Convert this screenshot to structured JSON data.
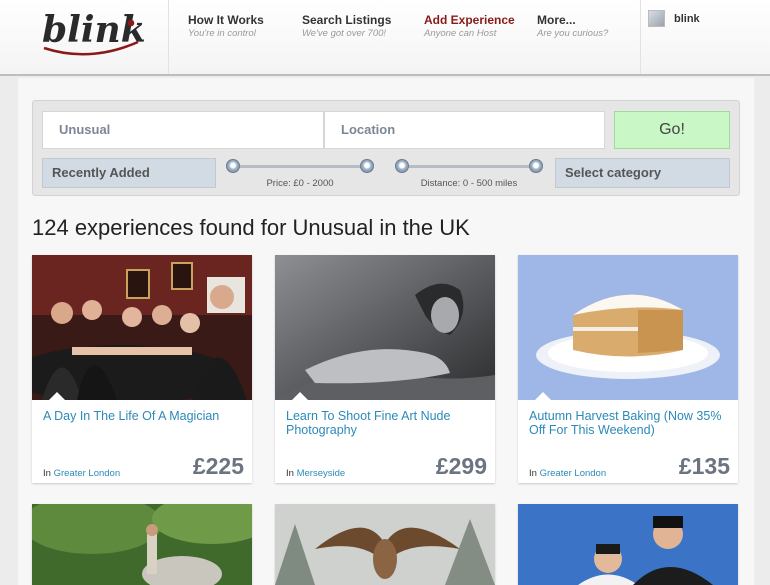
{
  "brand": {
    "logo_text": "blink"
  },
  "nav": [
    {
      "label": "How It Works",
      "sub": "You're in control"
    },
    {
      "label": "Search Listings",
      "sub": "We've got over 700!"
    },
    {
      "label": "Add Experience",
      "sub": "Anyone can Host"
    },
    {
      "label": "More...",
      "sub": "Are you curious?"
    }
  ],
  "user": {
    "name": "blink"
  },
  "search": {
    "keyword_value": "Unusual",
    "location_placeholder": "Location",
    "go_label": "Go!",
    "sort_label": "Recently Added",
    "category_label": "Select category",
    "price_label": "Price: £0 - 2000",
    "distance_label": "Distance: 0 - 500 miles"
  },
  "results": {
    "heading": "124 experiences found for Unusual in the UK",
    "location_prefix": "In",
    "items": [
      {
        "title": "A Day In The Life Of A Magician",
        "location": "Greater London",
        "price": "£225"
      },
      {
        "title": "Learn To Shoot Fine Art Nude Photography",
        "location": "Merseyside",
        "price": "£299"
      },
      {
        "title": "Autumn Harvest Baking (Now 35% Off For This Weekend)",
        "location": "Greater London",
        "price": "£135"
      }
    ]
  },
  "colors": {
    "accent_link": "#2b8ab8",
    "active_nav": "#8a1a1a",
    "go_button": "#c9f7c5",
    "price": "#6b7480"
  },
  "icons": [
    "user-avatar"
  ]
}
